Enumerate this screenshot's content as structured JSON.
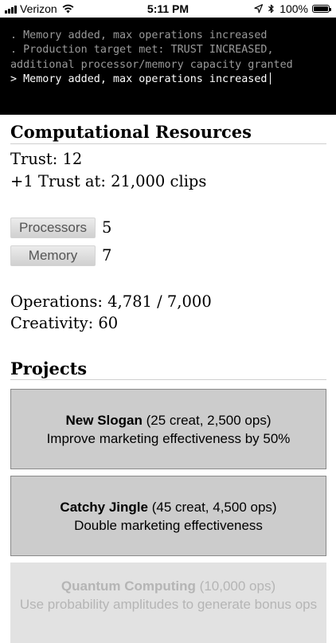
{
  "status_bar": {
    "carrier": "Verizon",
    "time": "5:11 PM",
    "battery": "100%",
    "battery_level": 1.0,
    "icons": [
      "signal-icon",
      "wifi-icon",
      "location-arrow-icon",
      "bluetooth-icon",
      "battery-icon"
    ]
  },
  "console": {
    "lines": [
      ". Memory added, max operations increased",
      ". Production target met: TRUST INCREASED, additional processor/memory capacity granted"
    ],
    "current": "> Memory added, max operations increased"
  },
  "resources": {
    "title": "Computational Resources",
    "trust": "Trust: 12",
    "next_trust": "+1 Trust at: 21,000 clips",
    "processors_label": "Processors",
    "processors_value": "5",
    "memory_label": "Memory",
    "memory_value": "7",
    "operations": "Operations: 4,781 / 7,000",
    "creativity": "Creativity: 60"
  },
  "projects": {
    "title": "Projects",
    "items": [
      {
        "title": "New Slogan",
        "cost": "(25 creat, 2,500 ops)",
        "description": "Improve marketing effectiveness by 50%"
      },
      {
        "title": "Catchy Jingle",
        "cost": "(45 creat, 4,500 ops)",
        "description": "Double marketing effectiveness"
      },
      {
        "title": "Quantum Computing",
        "cost": "(10,000 ops)",
        "description": "Use probability amplitudes to generate bonus ops"
      }
    ]
  },
  "colors": {
    "console_bg": "#000000",
    "console_old_text": "#9a9a9a",
    "console_current_text": "#ffffff",
    "project_bg": "#cccccc",
    "project_disabled_bg": "#e2e2e2",
    "project_disabled_text": "#b5b5b5"
  }
}
